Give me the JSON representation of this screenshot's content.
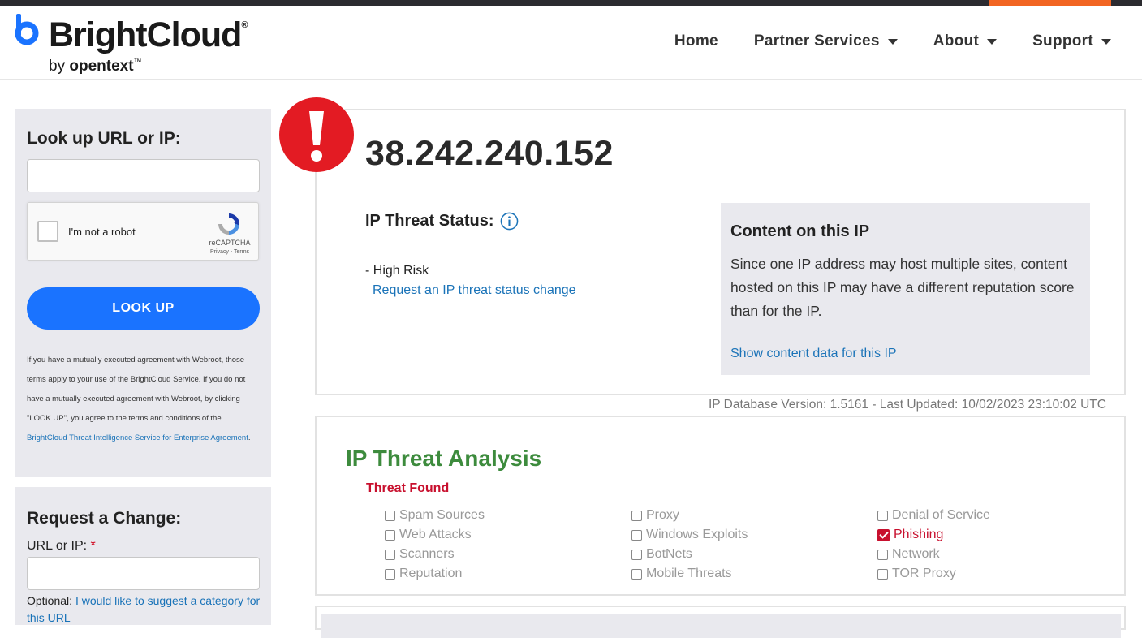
{
  "brand": {
    "name": "BrightCloud",
    "reg": "®",
    "by_prefix": "by ",
    "by_company": "opentext",
    "tm": "™"
  },
  "nav": {
    "home": "Home",
    "partner_services": "Partner Services",
    "about": "About",
    "support": "Support"
  },
  "lookup": {
    "title": "Look up URL or IP:",
    "input_value": "",
    "captcha_label": "I'm not a robot",
    "captcha_brand": "reCAPTCHA",
    "captcha_links": "Privacy - Terms",
    "button_label": "LOOK UP",
    "legal_text": "If you have a mutually executed agreement with Webroot, those terms apply to your use of the BrightCloud Service. If you do not have a mutually executed agreement with Webroot, by clicking \"LOOK UP\", you agree to the terms and conditions of the ",
    "legal_link": "BrightCloud Threat Intelligence Service for Enterprise Agreement",
    "legal_end": "."
  },
  "change": {
    "title": "Request a Change:",
    "field_label": "URL or IP: ",
    "required_mark": "*",
    "input_value": "",
    "optional_prefix": "Optional: ",
    "optional_link": "I would like to suggest a category for this URL"
  },
  "result": {
    "ip": "38.242.240.152",
    "threat_status_label": "IP Threat Status:",
    "risk": "- High Risk",
    "request_change": "Request an IP threat status change",
    "content_title": "Content on this IP",
    "content_text": "Since one IP address may host multiple sites, content hosted on this IP may have a different reputation score than for the IP.",
    "content_link": "Show content data for this IP",
    "db_version": "IP Database Version: 1.5161 - Last Updated: 10/02/2023 23:10:02 UTC"
  },
  "analysis": {
    "title": "IP Threat Analysis",
    "threat_found": "Threat Found",
    "threats": [
      {
        "label": "Spam Sources",
        "checked": false
      },
      {
        "label": "Web Attacks",
        "checked": false
      },
      {
        "label": "Scanners",
        "checked": false
      },
      {
        "label": "Reputation",
        "checked": false
      },
      {
        "label": "Proxy",
        "checked": false
      },
      {
        "label": "Windows Exploits",
        "checked": false
      },
      {
        "label": "BotNets",
        "checked": false
      },
      {
        "label": "Mobile Threats",
        "checked": false
      },
      {
        "label": "Denial of Service",
        "checked": false
      },
      {
        "label": "Phishing",
        "checked": true
      },
      {
        "label": "Network",
        "checked": false
      },
      {
        "label": "TOR Proxy",
        "checked": false
      }
    ]
  },
  "colors": {
    "accent_orange": "#f26522",
    "button_blue": "#1a73ff",
    "link_blue": "#1a73b8",
    "alert_red": "#e31b23",
    "analysis_green": "#3d8b3d",
    "threat_red": "#c8102e"
  },
  "icons": {
    "alert": "exclamation-circle-icon",
    "info": "info-circle-icon",
    "caret": "caret-down-icon",
    "recaptcha": "recaptcha-icon"
  }
}
